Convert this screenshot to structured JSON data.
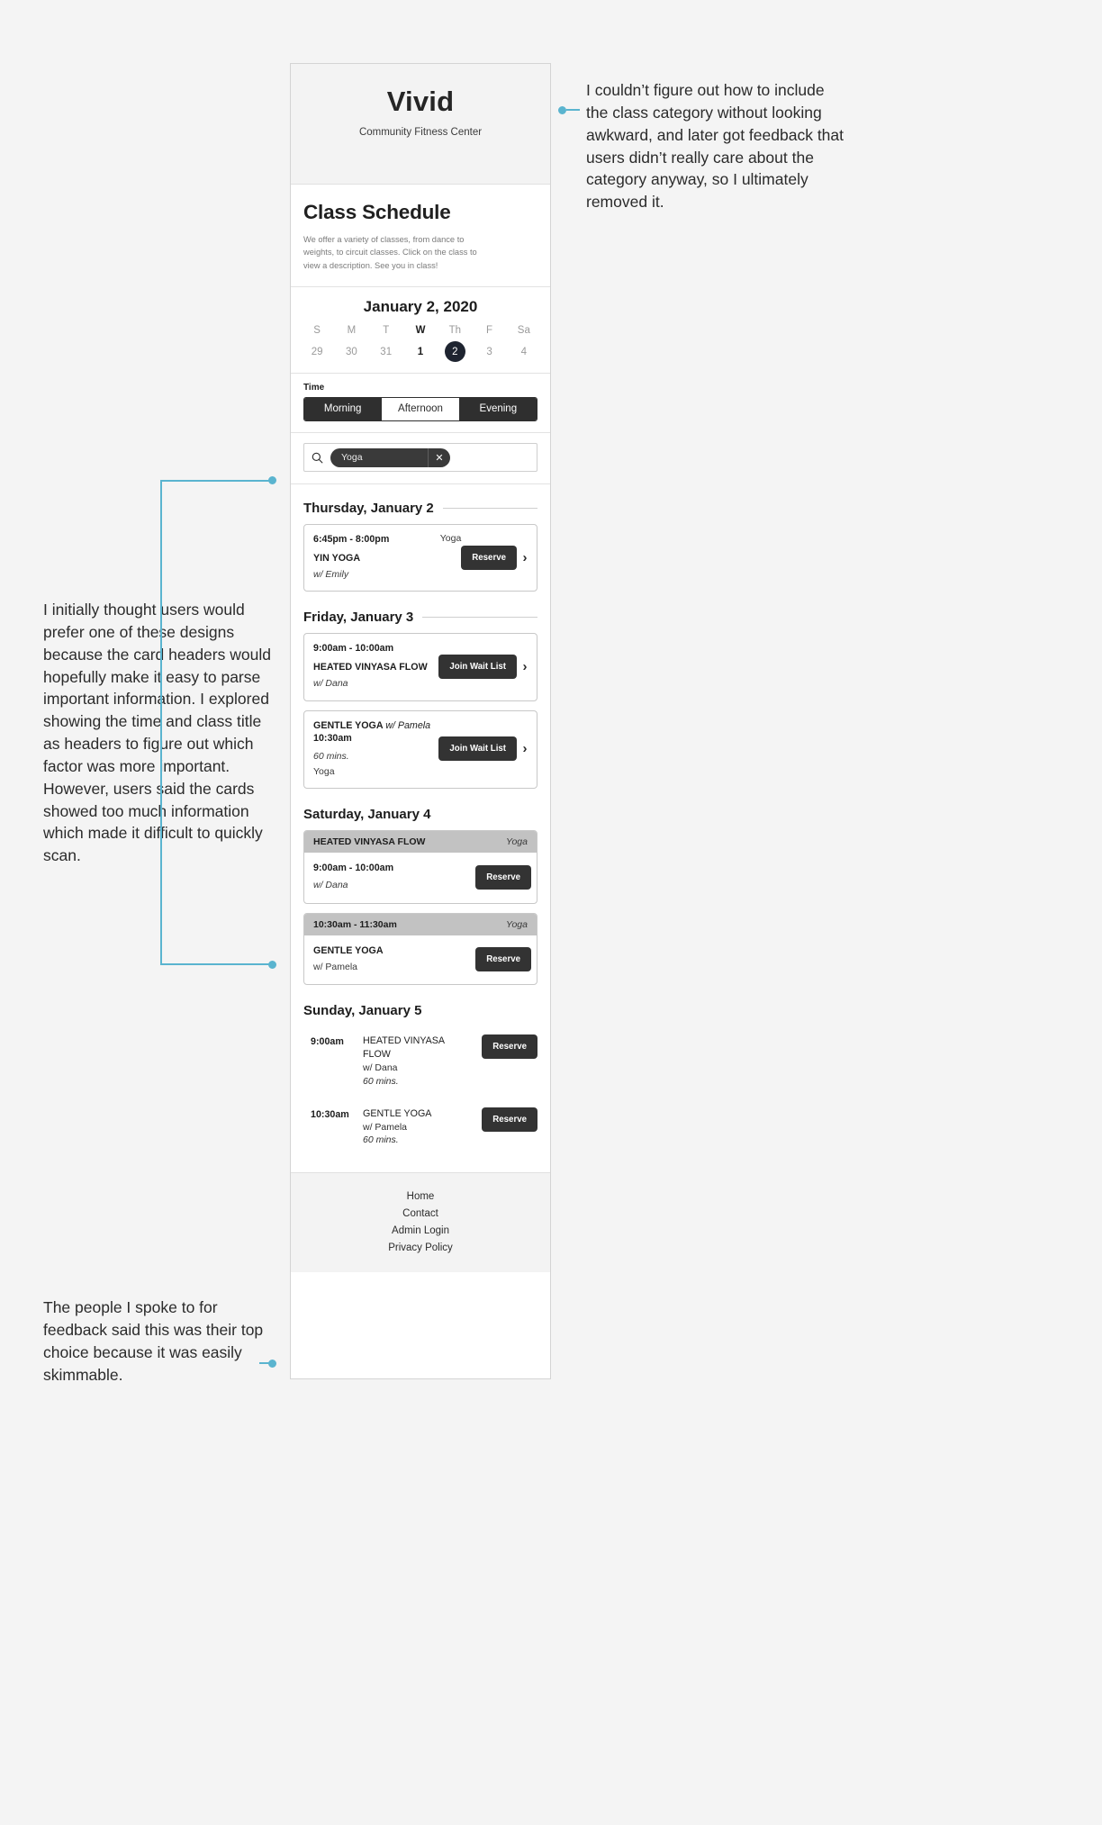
{
  "app": {
    "brand_name": "Vivid",
    "brand_tagline": "Community Fitness Center",
    "page_title": "Class Schedule",
    "page_description": "We offer a variety of classes, from dance to weights, to circuit classes. Click on the class to view a description. See you in class!"
  },
  "calendar": {
    "title": "January 2, 2020",
    "dow": [
      "S",
      "M",
      "T",
      "W",
      "Th",
      "F",
      "Sa"
    ],
    "current_dow_index": 3,
    "days": [
      "29",
      "30",
      "31",
      "1",
      "2",
      "3",
      "4"
    ],
    "selected_index": 4,
    "current_index": 3
  },
  "filters": {
    "time_label": "Time",
    "segments": [
      {
        "label": "Morning",
        "selected": true
      },
      {
        "label": "Afternoon",
        "selected": false
      },
      {
        "label": "Evening",
        "selected": true
      }
    ]
  },
  "search": {
    "icon": "search-icon",
    "chip_label": "Yoga",
    "chip_dismiss": "✕"
  },
  "schedule": {
    "days": [
      {
        "heading": "Thursday, January 2",
        "layout": "inline-header",
        "classes": [
          {
            "time": "6:45pm - 8:00pm",
            "category": "Yoga",
            "title": "YIN YOGA",
            "instructor": "w/ Emily",
            "action": "Reserve",
            "chevron": "›"
          }
        ]
      },
      {
        "heading": "Friday, January 3",
        "layout": "inline-header",
        "classes": [
          {
            "time": "9:00am - 10:00am",
            "category": "",
            "title": "HEATED VINYASA FLOW",
            "instructor": "w/ Dana",
            "action": "Join Wait List",
            "chevron": "›"
          },
          {
            "title": "GENTLE YOGA",
            "instructor": "w/ Pamela",
            "time": "10:30am",
            "duration": "60 mins.",
            "category": "Yoga",
            "action": "Join Wait List",
            "chevron": "›"
          }
        ]
      },
      {
        "heading": "Saturday, January 4",
        "layout": "gray-header",
        "classes": [
          {
            "header_left": "HEATED VINYASA FLOW",
            "header_right": "Yoga",
            "time": "9:00am - 10:00am",
            "instructor": "w/ Dana",
            "action": "Reserve"
          },
          {
            "header_left": "10:30am - 11:30am",
            "header_right": "Yoga",
            "title": "GENTLE YOGA",
            "instructor": "w/ Pamela",
            "action": "Reserve"
          }
        ]
      },
      {
        "heading": "Sunday, January 5",
        "layout": "list",
        "classes": [
          {
            "time": "9:00am",
            "title": "HEATED VINYASA FLOW",
            "instructor": "w/ Dana",
            "duration": "60 mins.",
            "action": "Reserve"
          },
          {
            "time": "10:30am",
            "title": "GENTLE YOGA",
            "instructor": "w/ Pamela",
            "duration": "60 mins.",
            "action": "Reserve"
          }
        ]
      }
    ]
  },
  "footer": {
    "links": [
      "Home",
      "Contact",
      "Admin Login",
      "Privacy Policy"
    ]
  },
  "annotations": {
    "right": "I couldn’t figure out how to include the class category without looking awkward, and later got feedback that users didn’t really care about the category anyway, so I ultimately removed it.",
    "left_top": "I initially thought users would prefer one of these designs because the card headers would hopefully make it easy to parse important information. I explored showing the time and class title as headers to figure out which factor was more important. However, users said the cards showed too much information which made it difficult to quickly scan.",
    "left_bottom": "The people I spoke to for feedback said this was their top choice because it was easily skimmable."
  },
  "colors": {
    "accent": "#5ab4cf",
    "dark": "#2f2f2f",
    "selected_day": "#1e2430",
    "card_header": "#c2c2c2"
  }
}
